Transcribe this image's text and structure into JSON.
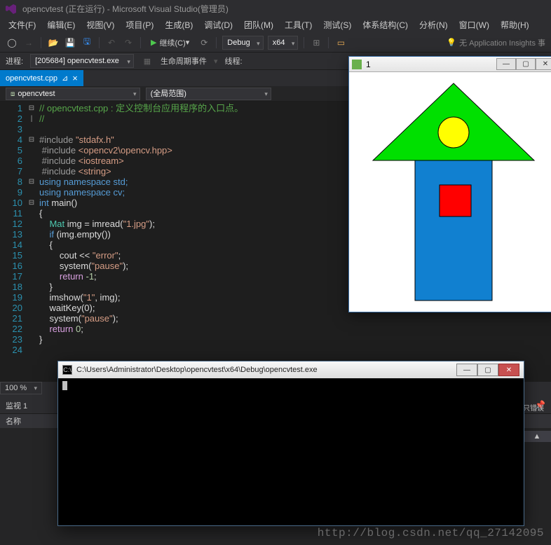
{
  "titlebar": {
    "text": "opencvtest (正在运行) - Microsoft Visual Studio(管理员)"
  },
  "menu": {
    "items": [
      "文件(F)",
      "编辑(E)",
      "视图(V)",
      "项目(P)",
      "生成(B)",
      "调试(D)",
      "团队(M)",
      "工具(T)",
      "测试(S)",
      "体系结构(C)",
      "分析(N)",
      "窗口(W)",
      "帮助(H)"
    ]
  },
  "toolbar": {
    "continue": "继续(C)",
    "config": "Debug",
    "platform": "x64",
    "insights": "无 Application Insights 事"
  },
  "process": {
    "label": "进程:",
    "value": "[205684] opencvtest.exe",
    "lifecycle": "生命周期事件",
    "thread": "线程:"
  },
  "doctab": {
    "file": "opencvtest.cpp"
  },
  "navbar": {
    "scope1": "opencvtest",
    "scope2": "(全局范围)"
  },
  "code": {
    "l1": "// opencvtest.cpp : 定义控制台应用程序的入口点。",
    "l2": "//",
    "l4a": "#include ",
    "l4b": "\"stdafx.h\"",
    "l5a": "#include ",
    "l5b": "<opencv2\\opencv.hpp>",
    "l6a": "#include ",
    "l6b": "<iostream>",
    "l7a": "#include ",
    "l7b": "<string>",
    "l8": "using namespace std;",
    "l9": "using namespace cv;",
    "l10a": "int ",
    "l10b": "main()",
    "l11": "{",
    "l12a": "Mat ",
    "l12b": "img = imread(",
    "l12c": "\"1.jpg\"",
    "l12d": ");",
    "l13a": "if ",
    "l13b": "(img.empty())",
    "l14": "{",
    "l15a": "cout << ",
    "l15b": "\"error\"",
    "l15c": ";",
    "l16a": "system(",
    "l16b": "\"pause\"",
    "l16c": ");",
    "l17a": "return ",
    "l17b": "-1",
    "l17c": ";",
    "l18": "}",
    "l19a": "imshow(",
    "l19b": "\"1\"",
    "l19c": ", img);",
    "l20": "waitKey(0);",
    "l21a": "system(",
    "l21b": "\"pause\"",
    "l21c": ");",
    "l22a": "return ",
    "l22b": "0",
    "l22c": ";",
    "l23": "}"
  },
  "zoom": {
    "value": "100 %"
  },
  "watch": {
    "title": "监视 1",
    "col1": "名称"
  },
  "imgwin": {
    "title": "1"
  },
  "console": {
    "title": "C:\\Users\\Administrator\\Desktop\\opencvtest\\x64\\Debug\\opencvtest.exe"
  },
  "rside": {
    "errlabel": "只错误"
  },
  "watermark": "http://blog.csdn.net/qq_27142095"
}
